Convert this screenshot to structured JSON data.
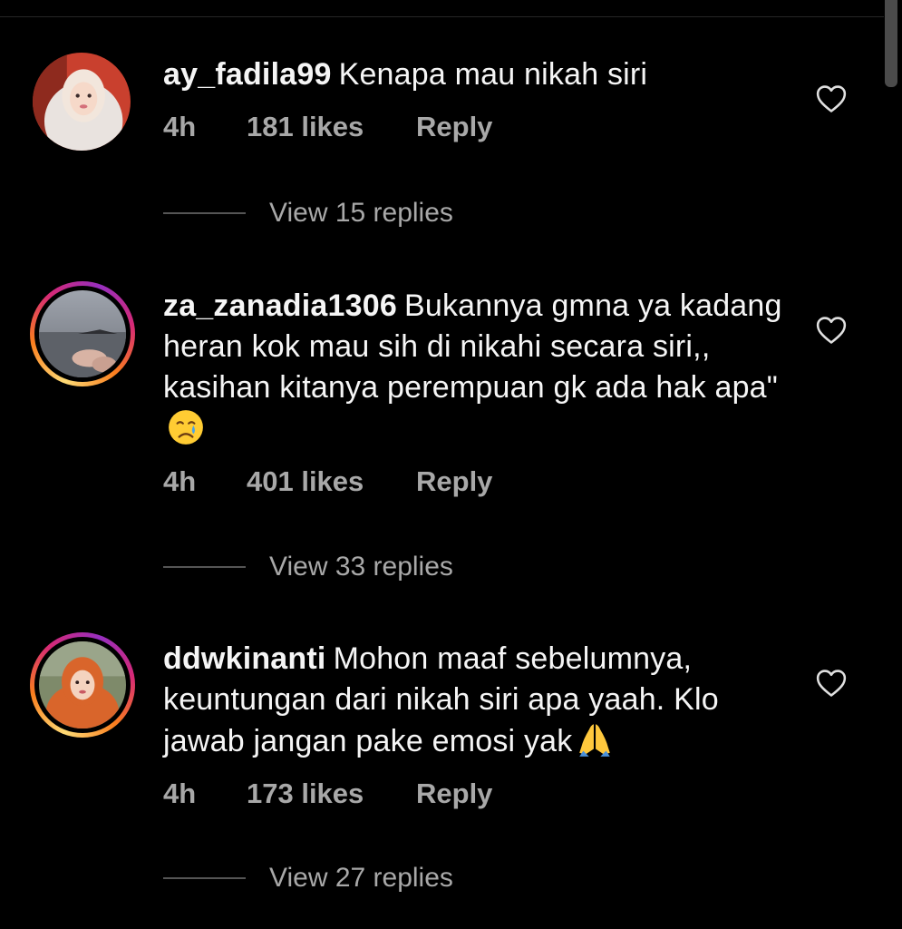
{
  "comments": [
    {
      "username": "ay_fadila99",
      "text": "Kenapa mau nikah siri",
      "emoji": "",
      "time": "4h",
      "likes": "181 likes",
      "reply_label": "Reply",
      "view_replies": "View 15 replies",
      "avatar_story_ring": false
    },
    {
      "username": "za_zanadia1306",
      "text": "Bukannya gmna ya kadang heran kok mau sih di nikahi secara siri,, kasihan kitanya perempuan gk ada hak apa\"",
      "emoji": "crying-face",
      "time": "4h",
      "likes": "401 likes",
      "reply_label": "Reply",
      "view_replies": "View 33 replies",
      "avatar_story_ring": true
    },
    {
      "username": "ddwkinanti",
      "text": "Mohon maaf sebelumnya, keuntungan dari nikah siri apa yaah. Klo jawab jangan pake emosi yak",
      "emoji": "folded-hands",
      "time": "4h",
      "likes": "173 likes",
      "reply_label": "Reply",
      "view_replies": "View 27 replies",
      "avatar_story_ring": true
    }
  ],
  "colors": {
    "background": "#000000",
    "text": "#f5f5f5",
    "secondary_text": "#a8a8a8",
    "story_ring_start": "#feda75",
    "story_ring_end": "#d62976"
  }
}
